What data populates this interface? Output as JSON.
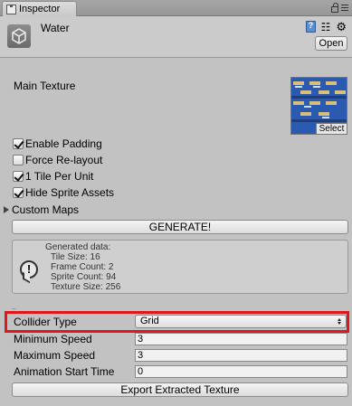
{
  "tab": {
    "title": "Inspector"
  },
  "header": {
    "asset_name": "Water",
    "open_label": "Open"
  },
  "texture": {
    "label": "Main Texture",
    "select_label": "Select"
  },
  "toggles": [
    {
      "label": "Enable Padding",
      "checked": true
    },
    {
      "label": "Force Re-layout",
      "checked": false
    },
    {
      "label": "1 Tile Per Unit",
      "checked": true
    },
    {
      "label": "Hide Sprite Assets",
      "checked": true
    }
  ],
  "custom_maps": {
    "label": "Custom Maps"
  },
  "generate_label": "GENERATE!",
  "generated_info": {
    "title": "Generated data:",
    "tile_size": "Tile Size: 16",
    "frame_count": "Frame Count: 2",
    "sprite_count": "Sprite Count: 94",
    "texture_size": "Texture Size: 256"
  },
  "collider": {
    "label": "Collider Type",
    "value": "Grid"
  },
  "fields": {
    "min_speed_label": "Minimum Speed",
    "min_speed_value": "3",
    "max_speed_label": "Maximum Speed",
    "max_speed_value": "3",
    "anim_start_label": "Animation Start Time",
    "anim_start_value": "0"
  },
  "export_label": "Export Extracted Texture",
  "colors": {
    "highlight": "#e0181b",
    "panel_bg": "#c2c2c2"
  }
}
